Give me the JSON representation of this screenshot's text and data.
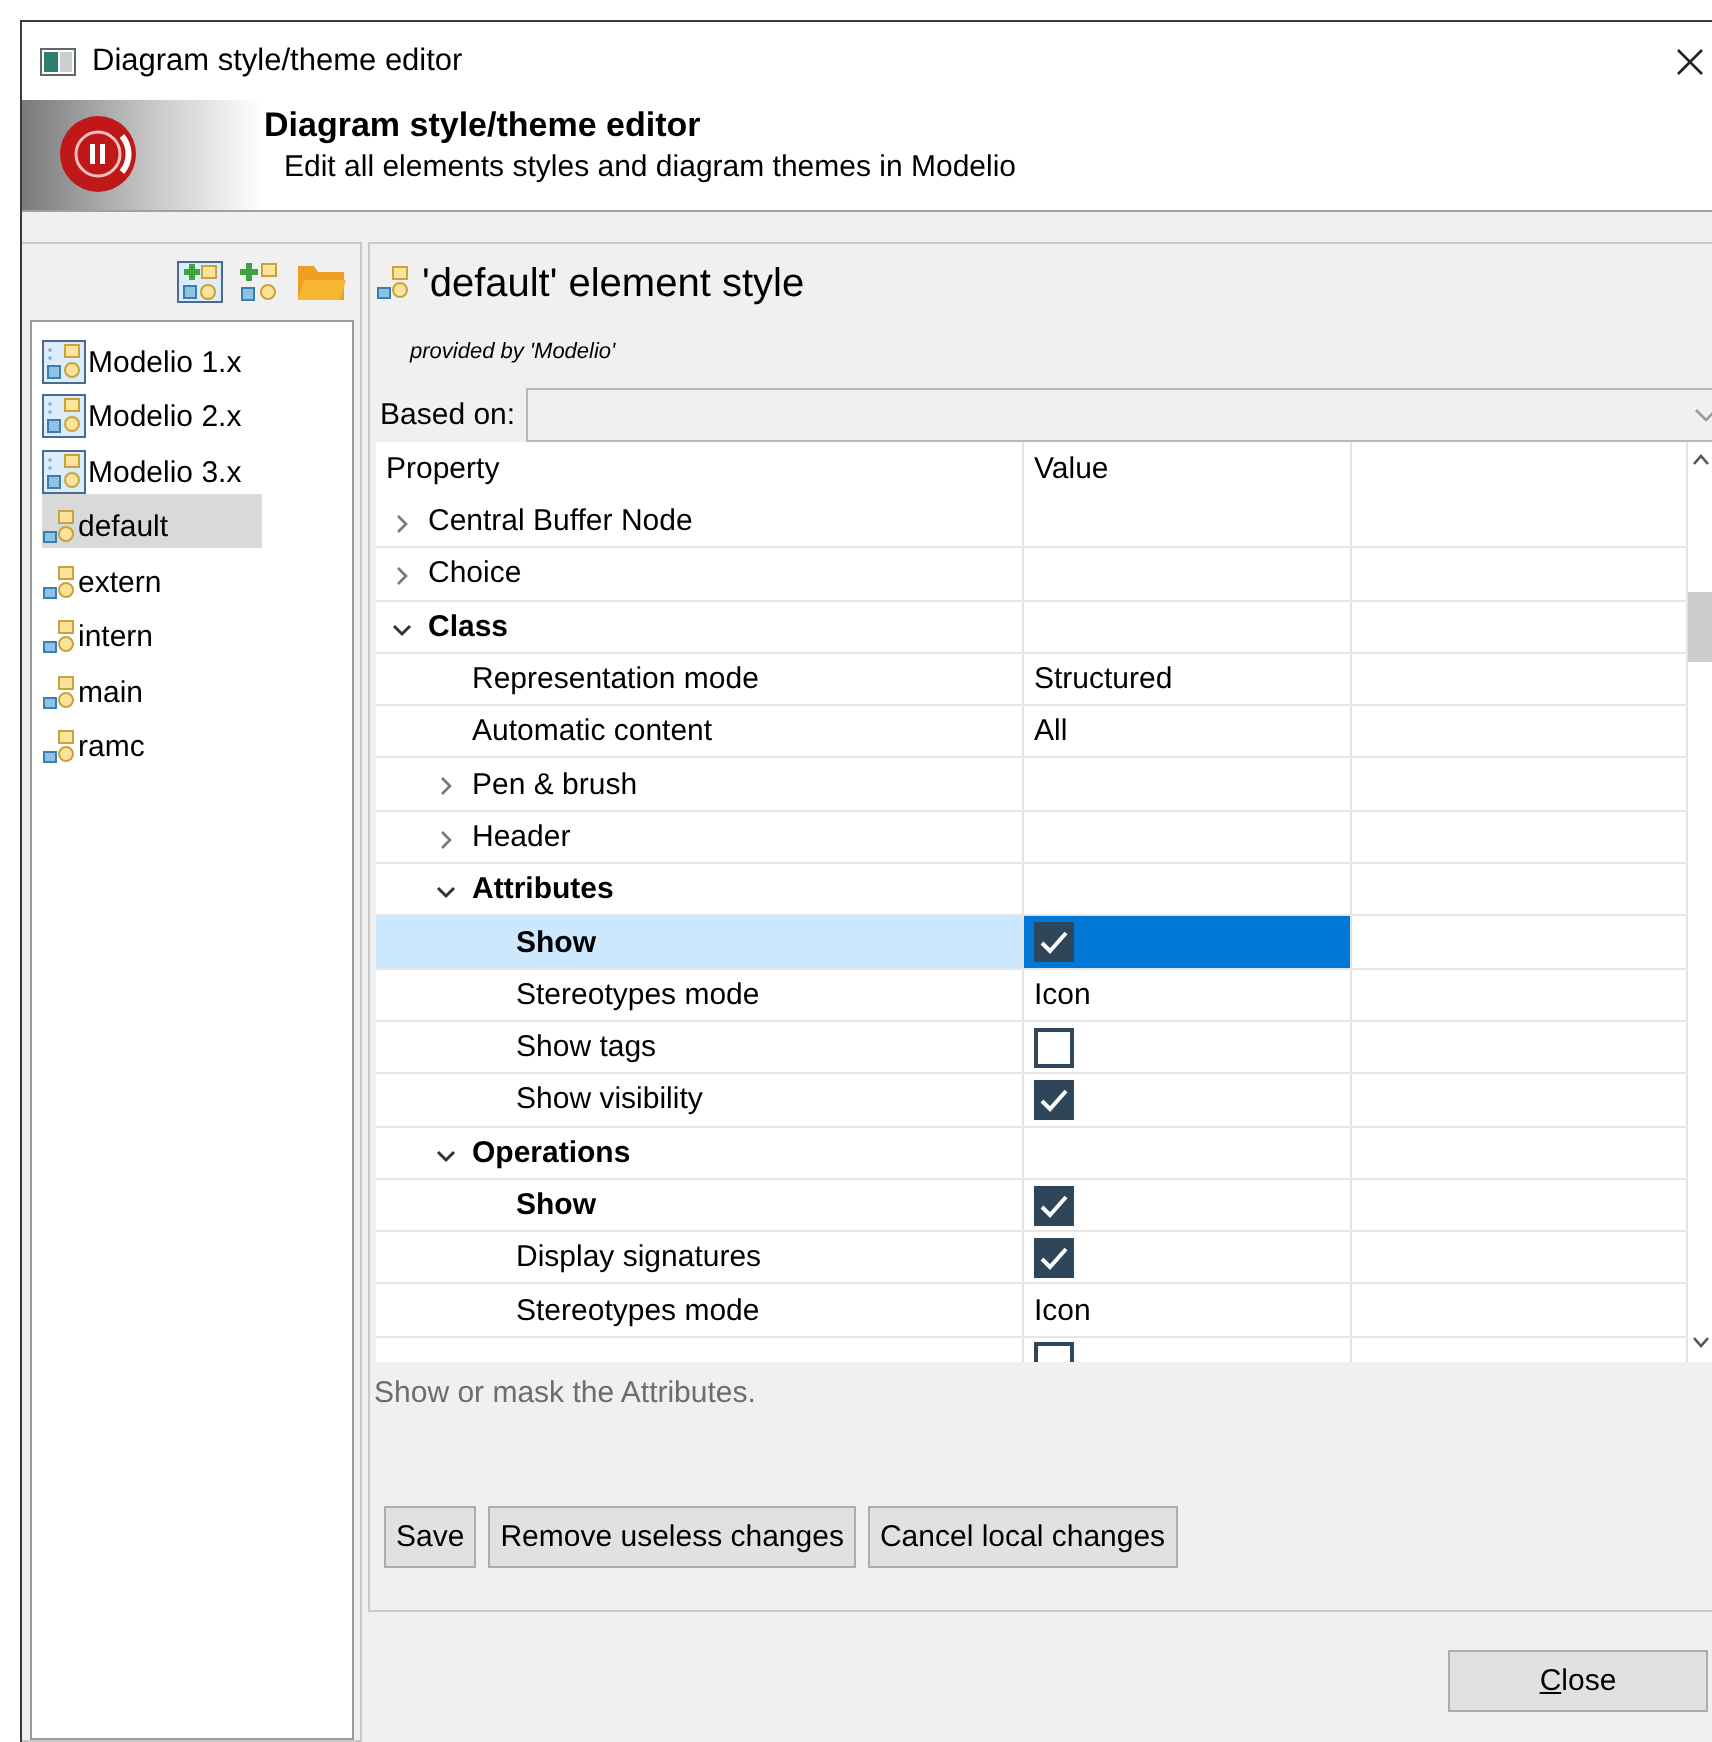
{
  "window": {
    "title": "Diagram style/theme editor"
  },
  "header": {
    "title": "Diagram style/theme editor",
    "subtitle": "Edit all elements styles and diagram themes in Modelio"
  },
  "tree": {
    "items": [
      {
        "label": "Modelio 1.x",
        "kind": "theme",
        "selected": false
      },
      {
        "label": "Modelio 2.x",
        "kind": "theme",
        "selected": false
      },
      {
        "label": "Modelio 3.x",
        "kind": "theme",
        "selected": false
      },
      {
        "label": "default",
        "kind": "style",
        "selected": true
      },
      {
        "label": "extern",
        "kind": "style",
        "selected": false
      },
      {
        "label": "intern",
        "kind": "style",
        "selected": false
      },
      {
        "label": "main",
        "kind": "style",
        "selected": false
      },
      {
        "label": "ramc",
        "kind": "style",
        "selected": false
      }
    ]
  },
  "editor": {
    "title": "'default' element style",
    "provider": "provided by 'Modelio'",
    "based_on": {
      "label": "Based on:",
      "disabled": true
    }
  },
  "table": {
    "columns": [
      "Property",
      "Value"
    ],
    "rows": [
      {
        "label": "Central Buffer Node",
        "kind": "group",
        "bold": false,
        "expanded": false,
        "selected": false
      },
      {
        "label": "Choice",
        "kind": "group",
        "bold": false,
        "expanded": false,
        "selected": false
      },
      {
        "label": "Class",
        "kind": "group",
        "bold": true,
        "expanded": true,
        "selected": false,
        "children": [
          {
            "label": "Representation mode",
            "kind": "text",
            "bold": false,
            "value": "Structured",
            "selected": false
          },
          {
            "label": "Automatic content",
            "kind": "text",
            "bold": false,
            "value": "All",
            "selected": false
          },
          {
            "label": "Pen & brush",
            "kind": "group",
            "bold": false,
            "expanded": false,
            "selected": false
          },
          {
            "label": "Header",
            "kind": "group",
            "bold": false,
            "expanded": false,
            "selected": false
          },
          {
            "label": "Attributes",
            "kind": "group",
            "bold": true,
            "expanded": true,
            "selected": false,
            "children": [
              {
                "label": "Show",
                "kind": "check",
                "bold": true,
                "checked": true,
                "selected": true
              },
              {
                "label": "Stereotypes mode",
                "kind": "text",
                "bold": false,
                "value": "Icon",
                "selected": false
              },
              {
                "label": "Show tags",
                "kind": "check",
                "bold": false,
                "checked": false,
                "selected": false
              },
              {
                "label": "Show visibility",
                "kind": "check",
                "bold": false,
                "checked": true,
                "selected": false
              }
            ]
          },
          {
            "label": "Operations",
            "kind": "group",
            "bold": true,
            "expanded": true,
            "selected": false,
            "children": [
              {
                "label": "Show",
                "kind": "check",
                "bold": true,
                "checked": true,
                "selected": false
              },
              {
                "label": "Display signatures",
                "kind": "check",
                "bold": false,
                "checked": true,
                "selected": false
              },
              {
                "label": "Stereotypes mode",
                "kind": "text",
                "bold": false,
                "value": "Icon",
                "selected": false
              },
              {
                "kind": "check",
                "checked": false,
                "selected": false
              }
            ]
          }
        ]
      }
    ]
  },
  "description": "Show or mask the Attributes.",
  "buttons": [
    {
      "label": "Save"
    },
    {
      "label": "Remove useless changes"
    },
    {
      "label": "Cancel local changes"
    }
  ],
  "close_button": {
    "label": "Close",
    "mnemonic": true
  }
}
